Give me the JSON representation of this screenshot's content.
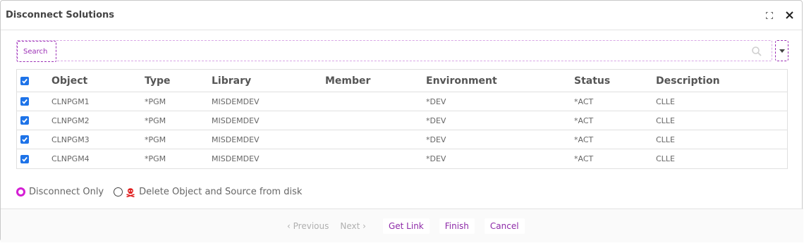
{
  "dialog": {
    "title": "Disconnect Solutions"
  },
  "search": {
    "label": "Search",
    "value": ""
  },
  "grid": {
    "columns": [
      "Object",
      "Type",
      "Library",
      "Member",
      "Environment",
      "Status",
      "Description"
    ],
    "rows": [
      {
        "object": "CLNPGM1",
        "type": "*PGM",
        "library": "MISDEMDEV",
        "member": "",
        "environment": "*DEV",
        "status": "*ACT",
        "description": "CLLE",
        "checked": true
      },
      {
        "object": "CLNPGM2",
        "type": "*PGM",
        "library": "MISDEMDEV",
        "member": "",
        "environment": "*DEV",
        "status": "*ACT",
        "description": "CLLE",
        "checked": true
      },
      {
        "object": "CLNPGM3",
        "type": "*PGM",
        "library": "MISDEMDEV",
        "member": "",
        "environment": "*DEV",
        "status": "*ACT",
        "description": "CLLE",
        "checked": true
      },
      {
        "object": "CLNPGM4",
        "type": "*PGM",
        "library": "MISDEMDEV",
        "member": "",
        "environment": "*DEV",
        "status": "*ACT",
        "description": "CLLE",
        "checked": true
      }
    ]
  },
  "options": {
    "disconnect_only": "Disconnect Only",
    "delete_object": "Delete Object and Source from disk",
    "selected": "disconnect_only"
  },
  "footer": {
    "previous": "Previous",
    "next": "Next",
    "get_link": "Get Link",
    "finish": "Finish",
    "cancel": "Cancel"
  },
  "colors": {
    "accent": "#9b2fb5",
    "radio_selected": "#d41fd4",
    "checkbox": "#1e73e8",
    "danger_icon": "#e02020"
  }
}
